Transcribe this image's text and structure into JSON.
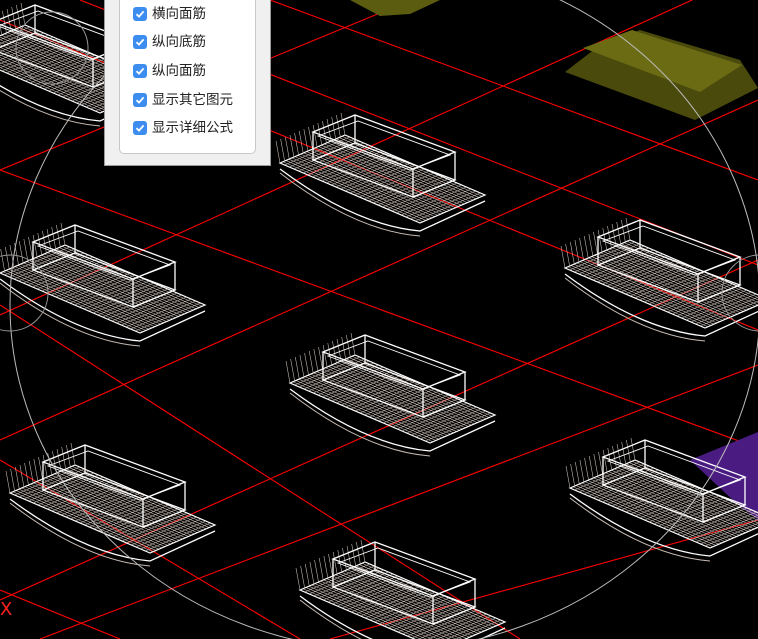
{
  "panel": {
    "options": [
      {
        "label": "横向面筋",
        "checked": true
      },
      {
        "label": "纵向底筋",
        "checked": true
      },
      {
        "label": "纵向面筋",
        "checked": true
      },
      {
        "label": "显示其它图元",
        "checked": true
      },
      {
        "label": "显示详细公式",
        "checked": true
      }
    ]
  },
  "axis": {
    "x_label": "X"
  },
  "colors": {
    "background": "#000000",
    "grid": "#ff0000",
    "rebar": "#c8bcb4",
    "cage": "#ffffff",
    "slab": "#5c5c10",
    "purple_element": "#4a1c82",
    "checkbox": "#3d8df0"
  }
}
